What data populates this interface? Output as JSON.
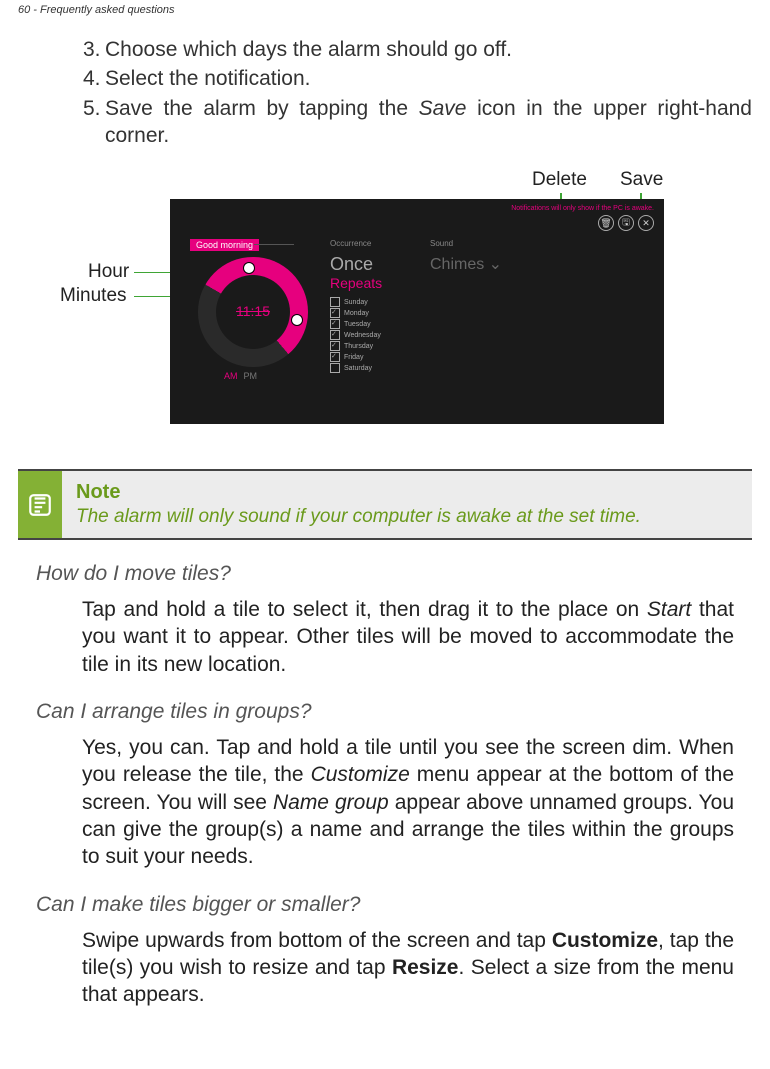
{
  "header": "60 - Frequently asked questions",
  "steps": {
    "s3_num": "3.",
    "s3_text": "Choose which days the alarm should go off.",
    "s4_num": "4.",
    "s4_text": "Select the notification.",
    "s5_num": "5.",
    "s5_pre": "Save the alarm by tapping the ",
    "s5_italic": "Save",
    "s5_post": " icon in the upper right-hand corner."
  },
  "figure": {
    "label_delete": "Delete",
    "label_save": "Save",
    "label_hour": "Hour",
    "label_minutes": "Minutes"
  },
  "shot": {
    "notif_text": "Notifications will only show if the PC is awake.",
    "good_morning": "Good morning",
    "time": "11:15",
    "am": "AM",
    "pm": "PM",
    "occurrence_hdr": "Occurrence",
    "once": "Once",
    "repeats": "Repeats",
    "days": [
      "Sunday",
      "Monday",
      "Tuesday",
      "Wednesday",
      "Thursday",
      "Friday",
      "Saturday"
    ],
    "days_checked": [
      false,
      true,
      true,
      true,
      true,
      true,
      false
    ],
    "sound_hdr": "Sound",
    "chimes": "Chimes",
    "btn_delete": "🗑",
    "btn_save": "🖫",
    "btn_close": "✕"
  },
  "note": {
    "title": "Note",
    "body": "The alarm will only sound if your computer is awake at the set time."
  },
  "q1": {
    "heading": "How do I move tiles?",
    "para_pre": "Tap and hold a tile to select it, then drag it to the place on ",
    "para_italic": "Start",
    "para_post": " that you want it to appear. Other tiles will be moved to accommodate the tile in its new location."
  },
  "q2": {
    "heading": "Can I arrange tiles in groups?",
    "para_pre": "Yes, you can. Tap and hold a tile until you see the screen dim. When you release the tile, the ",
    "para_italic1": "Customize",
    "para_mid": " menu appear at the bottom of the screen. You will see ",
    "para_italic2": "Name group",
    "para_post": " appear above unnamed groups. You can give the group(s) a name and arrange the tiles within the groups to suit your needs."
  },
  "q3": {
    "heading": "Can I make tiles bigger or smaller?",
    "para_pre": "Swipe upwards from bottom of the screen and tap ",
    "para_bold1": "Customize",
    "para_mid": ", tap the tile(s) you wish to resize and tap ",
    "para_bold2": "Resize",
    "para_post": ". Select a size from the menu that appears."
  }
}
